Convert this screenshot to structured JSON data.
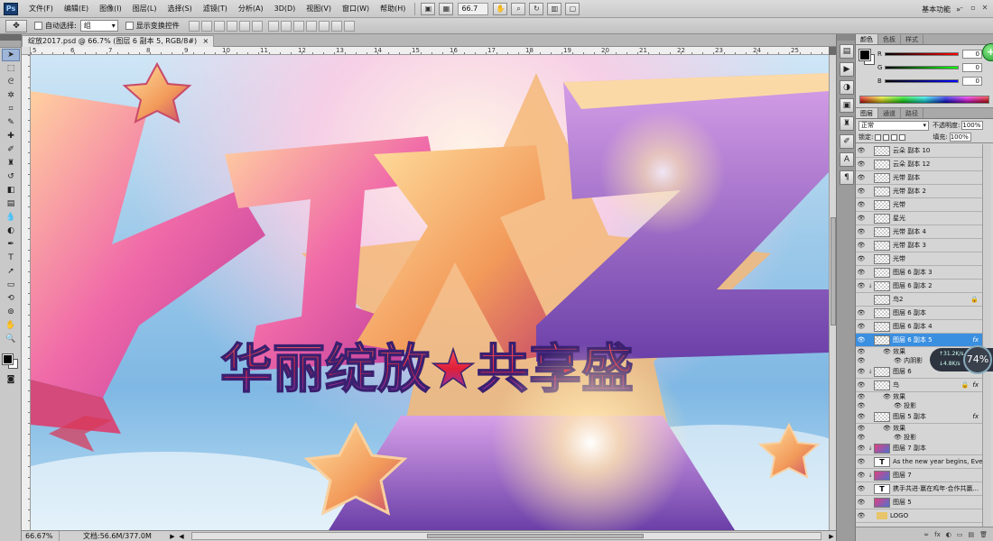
{
  "app": {
    "logo": "Ps",
    "workspace": "基本功能"
  },
  "menu": [
    "文件(F)",
    "编辑(E)",
    "图像(I)",
    "图层(L)",
    "选择(S)",
    "滤镜(T)",
    "分析(A)",
    "3D(D)",
    "视图(V)",
    "窗口(W)",
    "帮助(H)"
  ],
  "menubar_zoom": "66.7",
  "options": {
    "auto_select_label": "自动选择:",
    "auto_select_value": "组",
    "show_transform_label": "显示变换控件"
  },
  "document": {
    "tab_title": "绽放2017.psd @ 66.7% (图层 6 副本 5, RGB/8#)",
    "ruler_numbers": [
      "5",
      "6",
      "7",
      "8",
      "9",
      "10",
      "11",
      "12",
      "13",
      "14",
      "15",
      "16",
      "17",
      "18",
      "19",
      "20",
      "21",
      "22",
      "23",
      "24",
      "25"
    ],
    "banner_text": "华丽绽放★共享盛"
  },
  "status": {
    "zoom": "66.67%",
    "doc_info": "文档:56.6M/377.0M"
  },
  "color_panel": {
    "tabs": [
      "颜色",
      "色板",
      "样式"
    ],
    "rows": [
      {
        "letter": "R",
        "value": "0",
        "color": "#ff0000"
      },
      {
        "letter": "G",
        "value": "0",
        "color": "#00ff00"
      },
      {
        "letter": "B",
        "value": "0",
        "color": "#0000ff"
      }
    ]
  },
  "layers_panel": {
    "tabs": [
      "图层",
      "通道",
      "路径"
    ],
    "blend_mode": "正常",
    "opacity_label": "不透明度:",
    "opacity": "100%",
    "lock_label": "锁定:",
    "fill_label": "填充:",
    "fill": "100%",
    "layers": [
      {
        "name": "云朵 副本 10",
        "kind": "layer"
      },
      {
        "name": "云朵 副本 12",
        "kind": "layer"
      },
      {
        "name": "光带 副本",
        "kind": "layer"
      },
      {
        "name": "光带 副本 2",
        "kind": "layer"
      },
      {
        "name": "光带",
        "kind": "layer"
      },
      {
        "name": "星光",
        "kind": "layer"
      },
      {
        "name": "光带 副本 4",
        "kind": "layer"
      },
      {
        "name": "光带 副本 3",
        "kind": "layer"
      },
      {
        "name": "光带",
        "kind": "layer"
      },
      {
        "name": "图层 6 副本 3",
        "kind": "layer"
      },
      {
        "name": "图层 6 副本 2",
        "kind": "layer",
        "chain": true
      },
      {
        "name": "鸟2",
        "kind": "layer",
        "hidden": true,
        "lock": true
      },
      {
        "name": "图层 6 副本",
        "kind": "layer"
      },
      {
        "name": "图层 6 副本 4",
        "kind": "layer"
      },
      {
        "name": "图层 6 副本 5",
        "kind": "layer",
        "selected": true,
        "fx": true
      },
      {
        "name": "效果",
        "kind": "sub"
      },
      {
        "name": "内阴影",
        "kind": "subdeep"
      },
      {
        "name": "图层 6",
        "kind": "layer",
        "chain": true
      },
      {
        "name": "鸟",
        "kind": "layer",
        "lock": true,
        "fx": true
      },
      {
        "name": "效果",
        "kind": "sub"
      },
      {
        "name": "投影",
        "kind": "subdeep"
      },
      {
        "name": "图层 5 副本",
        "kind": "layer",
        "fx": true
      },
      {
        "name": "效果",
        "kind": "sub"
      },
      {
        "name": "投影",
        "kind": "subdeep"
      },
      {
        "name": "图层 7 副本",
        "kind": "img",
        "chain": true
      },
      {
        "name": "As the new year begins, Everyt...",
        "kind": "text"
      },
      {
        "name": "图层 7",
        "kind": "img",
        "chain": true
      },
      {
        "name": "携手共进·赢在鸡年·合作共赢...",
        "kind": "text"
      },
      {
        "name": "图层 5",
        "kind": "img"
      },
      {
        "name": "LOGO",
        "kind": "folder"
      }
    ],
    "fx_label": "fx",
    "bottom_icons": [
      "∞",
      "fx",
      "◐",
      "▭",
      "▤",
      "🗑"
    ]
  },
  "network": {
    "up": "↑31.2K/s",
    "down": "↓4.8K/s",
    "percent": "74%"
  }
}
